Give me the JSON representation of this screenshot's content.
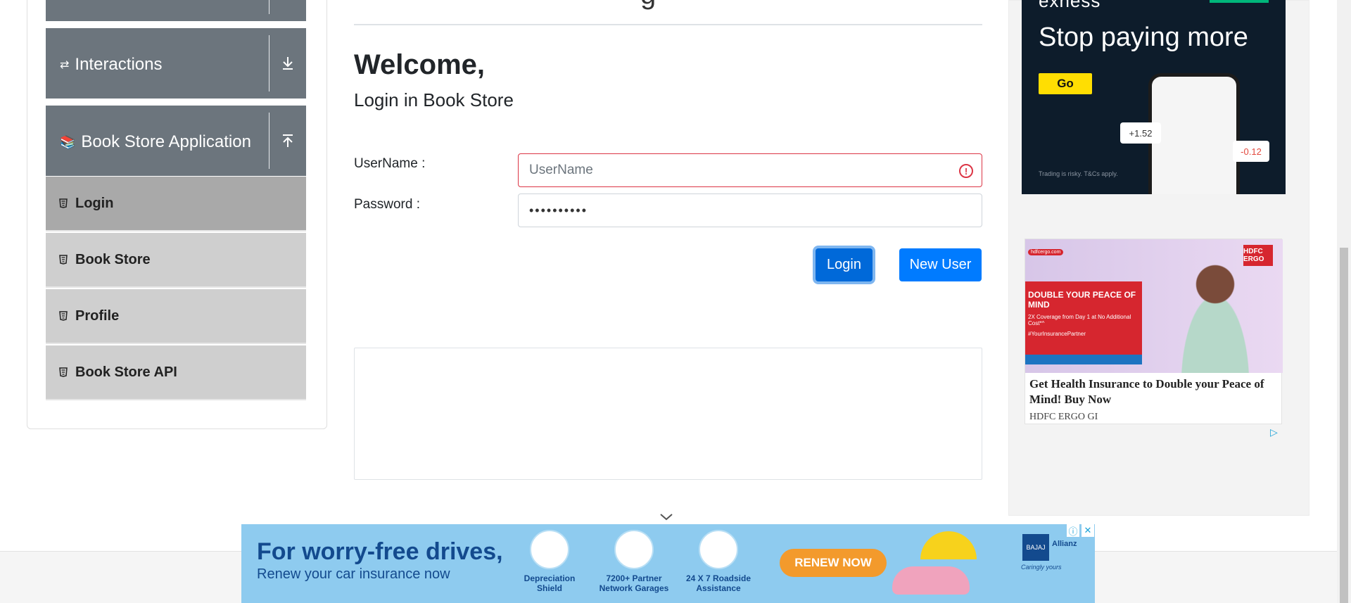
{
  "sidebar": {
    "groups": [
      {
        "label": "Interactions",
        "icon": "interactions-icon",
        "arrow": "download-arrow-icon"
      },
      {
        "label": "Book Store Application",
        "icon": "books-icon",
        "arrow": "upload-arrow-icon"
      }
    ],
    "items": [
      {
        "label": "Login",
        "icon": "html5-icon",
        "active": true
      },
      {
        "label": "Book Store",
        "icon": "html5-icon"
      },
      {
        "label": "Profile",
        "icon": "html5-icon"
      },
      {
        "label": "Book Store API",
        "icon": "html5-icon"
      }
    ]
  },
  "main": {
    "welcome": "Welcome,",
    "subtitle": "Login in Book Store",
    "username_label": "UserName :",
    "username_placeholder": "UserName",
    "password_label": "Password :",
    "password_value": "••••••••••",
    "login_button": "Login",
    "new_user_button": "New User"
  },
  "ads": {
    "exness": {
      "headline": "Stop paying more",
      "cta": "Go",
      "tag_up": "+1.52",
      "tag_down": "-0.12",
      "disclaimer": "Trading is risky. T&Cs apply.",
      "brand": "exness"
    },
    "hdfc": {
      "site": "hdfcergo.com",
      "logo": "HDFC ERGO",
      "panel_title": "DOUBLE YOUR PEACE OF MIND",
      "panel_sub": "2X Coverage from Day 1 at No Additional Cost*^",
      "panel_hashtag": "#YourInsurancePartner",
      "copy": "Get Health Insurance to Double your Peace of Mind! Buy Now",
      "advertiser": "HDFC ERGO GI"
    },
    "bajaj": {
      "headline": "For worry-free drives,",
      "subline": "Renew your car insurance now",
      "features": [
        "Depreciation Shield",
        "7200+ Partner Network Garages",
        "24 X 7 Roadside Assistance"
      ],
      "cta": "RENEW NOW",
      "logo": "BAJAJ",
      "partner": "Allianz",
      "tagline": "Caringly yours"
    }
  },
  "colors": {
    "primary": "#007bff",
    "sidebar_header": "#6c757d",
    "menu_item": "#cfcfcf",
    "menu_active": "#a9a9a9",
    "error": "#dc3545"
  }
}
